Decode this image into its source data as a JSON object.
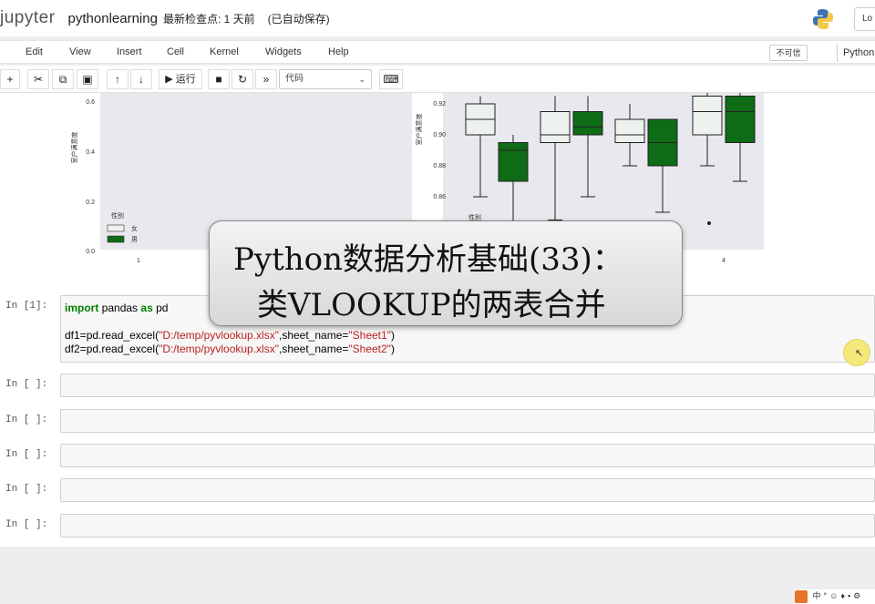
{
  "header": {
    "logo": "jupyter",
    "notebook_title": "pythonlearning",
    "checkpoint": "最新检查点: 1 天前",
    "autosave": "(已自动保存)",
    "logout_label": "Lo"
  },
  "menubar": {
    "items": [
      "Edit",
      "View",
      "Insert",
      "Cell",
      "Kernel",
      "Widgets",
      "Help"
    ],
    "trust_label": "不可信",
    "kernel_label": "Python"
  },
  "toolbar": {
    "run_label": "▶ 运行",
    "cell_type": "代码"
  },
  "output_chart": {
    "left_panel": {
      "ylabel": "室户满意度",
      "yticks": [
        "0.6",
        "0.4",
        "0.2",
        "0.0"
      ],
      "legend_title": "性别",
      "legend_items": [
        "女",
        "男"
      ],
      "xtick": "1"
    },
    "right_panel": {
      "ylabel": "室户满意度",
      "yticks": [
        "0.92",
        "0.90",
        "0.88",
        "0.86"
      ],
      "legend_title": "性别",
      "xtick": "4"
    }
  },
  "chart_data": {
    "type": "boxplot",
    "right_panel_series": [
      {
        "name": "女",
        "color": "#eef2ee",
        "boxes": [
          {
            "q1": 0.9,
            "median": 0.91,
            "q3": 0.92,
            "low": 0.86,
            "high": 0.925
          },
          {
            "q1": 0.895,
            "median": 0.9,
            "q3": 0.915,
            "low": 0.845,
            "high": 0.925
          },
          {
            "q1": 0.895,
            "median": 0.9,
            "q3": 0.91,
            "low": 0.88,
            "high": 0.92
          },
          {
            "q1": 0.9,
            "median": 0.915,
            "q3": 0.925,
            "low": 0.88,
            "high": 0.93
          }
        ]
      },
      {
        "name": "男",
        "color": "#0e6b16",
        "boxes": [
          {
            "q1": 0.87,
            "median": 0.89,
            "q3": 0.895,
            "low": 0.84,
            "high": 0.9
          },
          {
            "q1": 0.9,
            "median": 0.905,
            "q3": 0.915,
            "low": 0.86,
            "high": 0.925
          },
          {
            "q1": 0.88,
            "median": 0.895,
            "q3": 0.91,
            "low": 0.85,
            "high": 0.91
          },
          {
            "q1": 0.895,
            "median": 0.915,
            "q3": 0.925,
            "low": 0.87,
            "high": 0.93
          }
        ]
      }
    ]
  },
  "overlay": {
    "line1": "Python数据分析基础(33)：",
    "line2": "类VLOOKUP的两表合并"
  },
  "cells": [
    {
      "prompt": "In [1]:",
      "lines": [
        [
          {
            "t": "import",
            "c": "kw"
          },
          {
            "t": " pandas ",
            "c": ""
          },
          {
            "t": "as",
            "c": "kw"
          },
          {
            "t": " pd",
            "c": ""
          }
        ],
        [],
        [
          {
            "t": "df1=pd.read_excel(",
            "c": ""
          },
          {
            "t": "\"D:/temp/pyvlookup.xlsx\"",
            "c": "str"
          },
          {
            "t": ",sheet_name=",
            "c": ""
          },
          {
            "t": "\"Sheet1\"",
            "c": "str"
          },
          {
            "t": ")",
            "c": ""
          }
        ],
        [
          {
            "t": "df2=pd.read_excel(",
            "c": ""
          },
          {
            "t": "\"D:/temp/pyvlookup.xlsx\"",
            "c": "str"
          },
          {
            "t": ",sheet_name=",
            "c": ""
          },
          {
            "t": "\"Sheet2\"",
            "c": "str"
          },
          {
            "t": ")",
            "c": ""
          }
        ]
      ]
    },
    {
      "prompt": "In [ ]:",
      "lines": []
    },
    {
      "prompt": "In [ ]:",
      "lines": []
    },
    {
      "prompt": "In [ ]:",
      "lines": []
    },
    {
      "prompt": "In [ ]:",
      "lines": []
    },
    {
      "prompt": "In [ ]:",
      "lines": []
    }
  ],
  "tray": {
    "items": [
      "中",
      "°",
      "☺",
      "♦",
      "▪",
      "⚙"
    ]
  }
}
